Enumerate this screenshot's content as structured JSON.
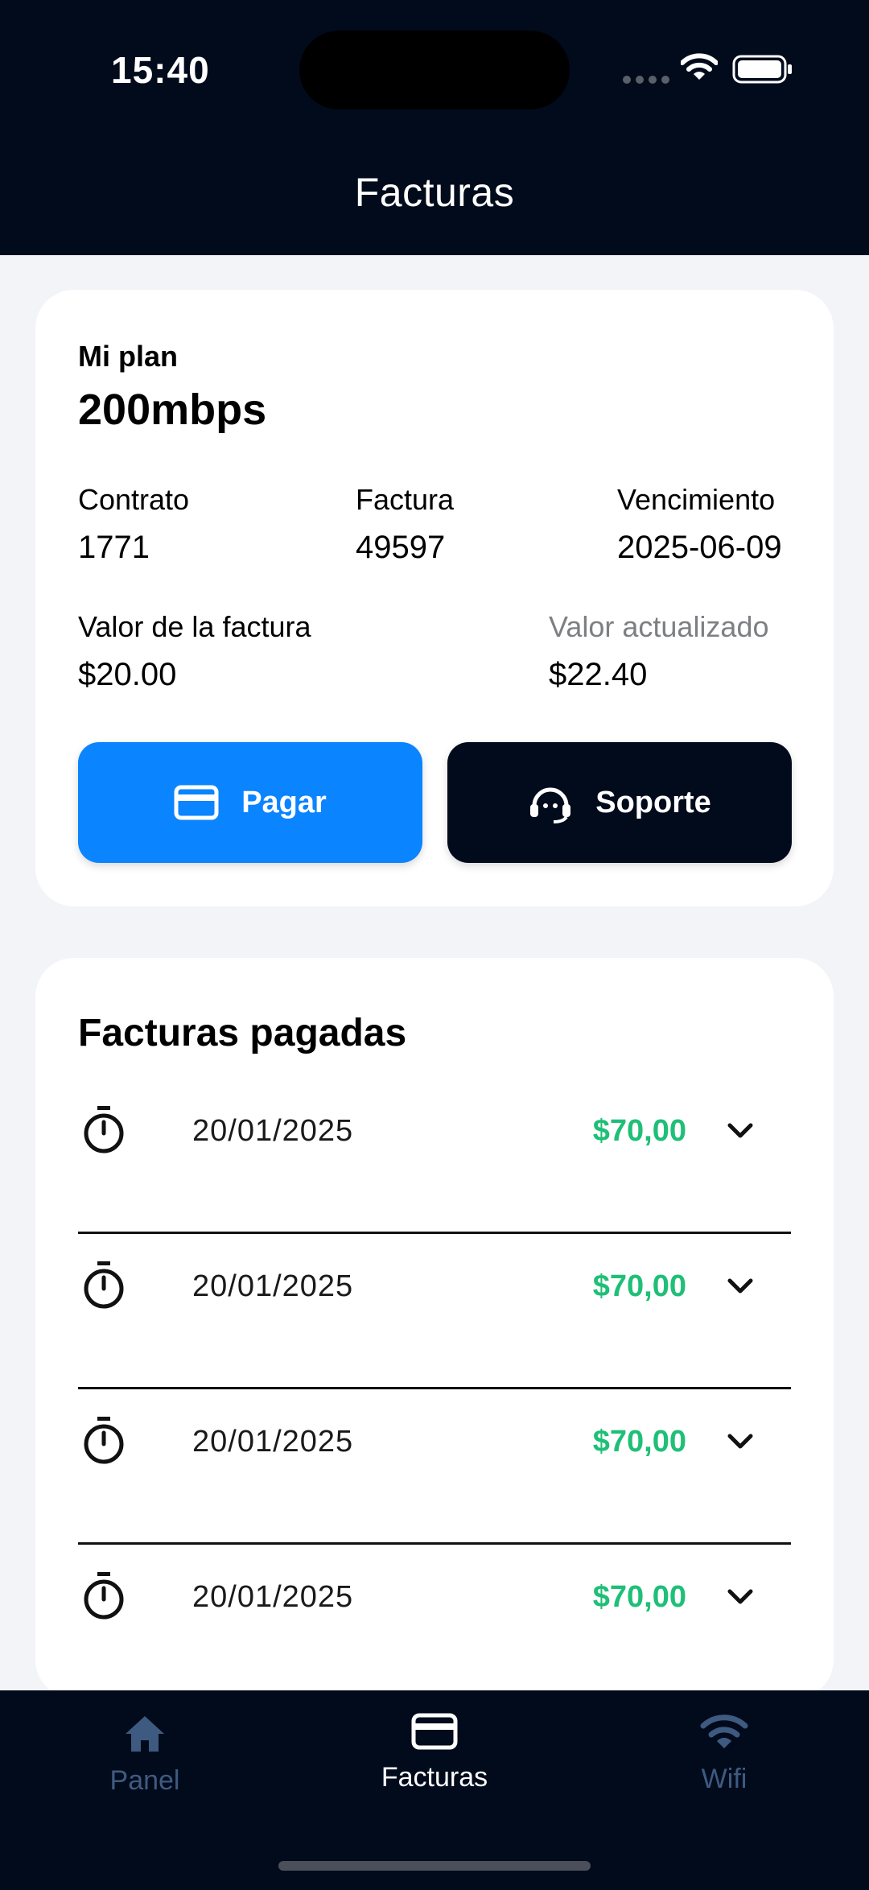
{
  "status_bar": {
    "time": "15:40"
  },
  "header": {
    "title": "Facturas"
  },
  "plan_card": {
    "plan_label": "Mi plan",
    "plan_value": "200mbps",
    "contract_label": "Contrato",
    "contract_value": "1771",
    "invoice_label": "Factura",
    "invoice_value": "49597",
    "due_label": "Vencimiento",
    "due_value": "2025-06-09",
    "amount_label": "Valor de la factura",
    "amount_value": "$20.00",
    "updated_label": "Valor actualizado",
    "updated_value": "$22.40",
    "pay_button": "Pagar",
    "support_button": "Soporte"
  },
  "paid_invoices": {
    "title": "Facturas pagadas",
    "rows": [
      {
        "date": "20/01/2025",
        "amount": "$70,00"
      },
      {
        "date": "20/01/2025",
        "amount": "$70,00"
      },
      {
        "date": "20/01/2025",
        "amount": "$70,00"
      },
      {
        "date": "20/01/2025",
        "amount": "$70,00"
      }
    ]
  },
  "bottom_nav": {
    "items": [
      {
        "label": "Panel",
        "icon": "home-icon",
        "active": false
      },
      {
        "label": "Facturas",
        "icon": "credit-card-icon",
        "active": true
      },
      {
        "label": "Wifi",
        "icon": "wifi-icon",
        "active": false
      }
    ]
  },
  "colors": {
    "header_bg": "#020b1c",
    "primary_blue": "#0a84ff",
    "amount_green": "#1fbf77",
    "inactive_nav": "#3f5a80"
  }
}
